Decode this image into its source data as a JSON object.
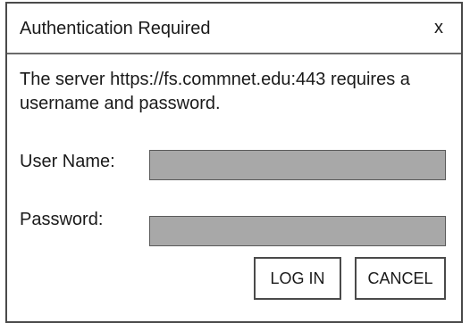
{
  "dialog": {
    "title": "Authentication Required",
    "close_label": "x",
    "message": "The server https://fs.commnet.edu:443 requires a username and password."
  },
  "form": {
    "username_label": "User Name:",
    "username_value": "",
    "password_label": "Password:",
    "password_value": ""
  },
  "buttons": {
    "login_label": "LOG IN",
    "cancel_label": "CANCEL"
  },
  "colors": {
    "input_fill": "#a8a8a8",
    "border": "#4a4a4a",
    "background": "#ffffff"
  }
}
